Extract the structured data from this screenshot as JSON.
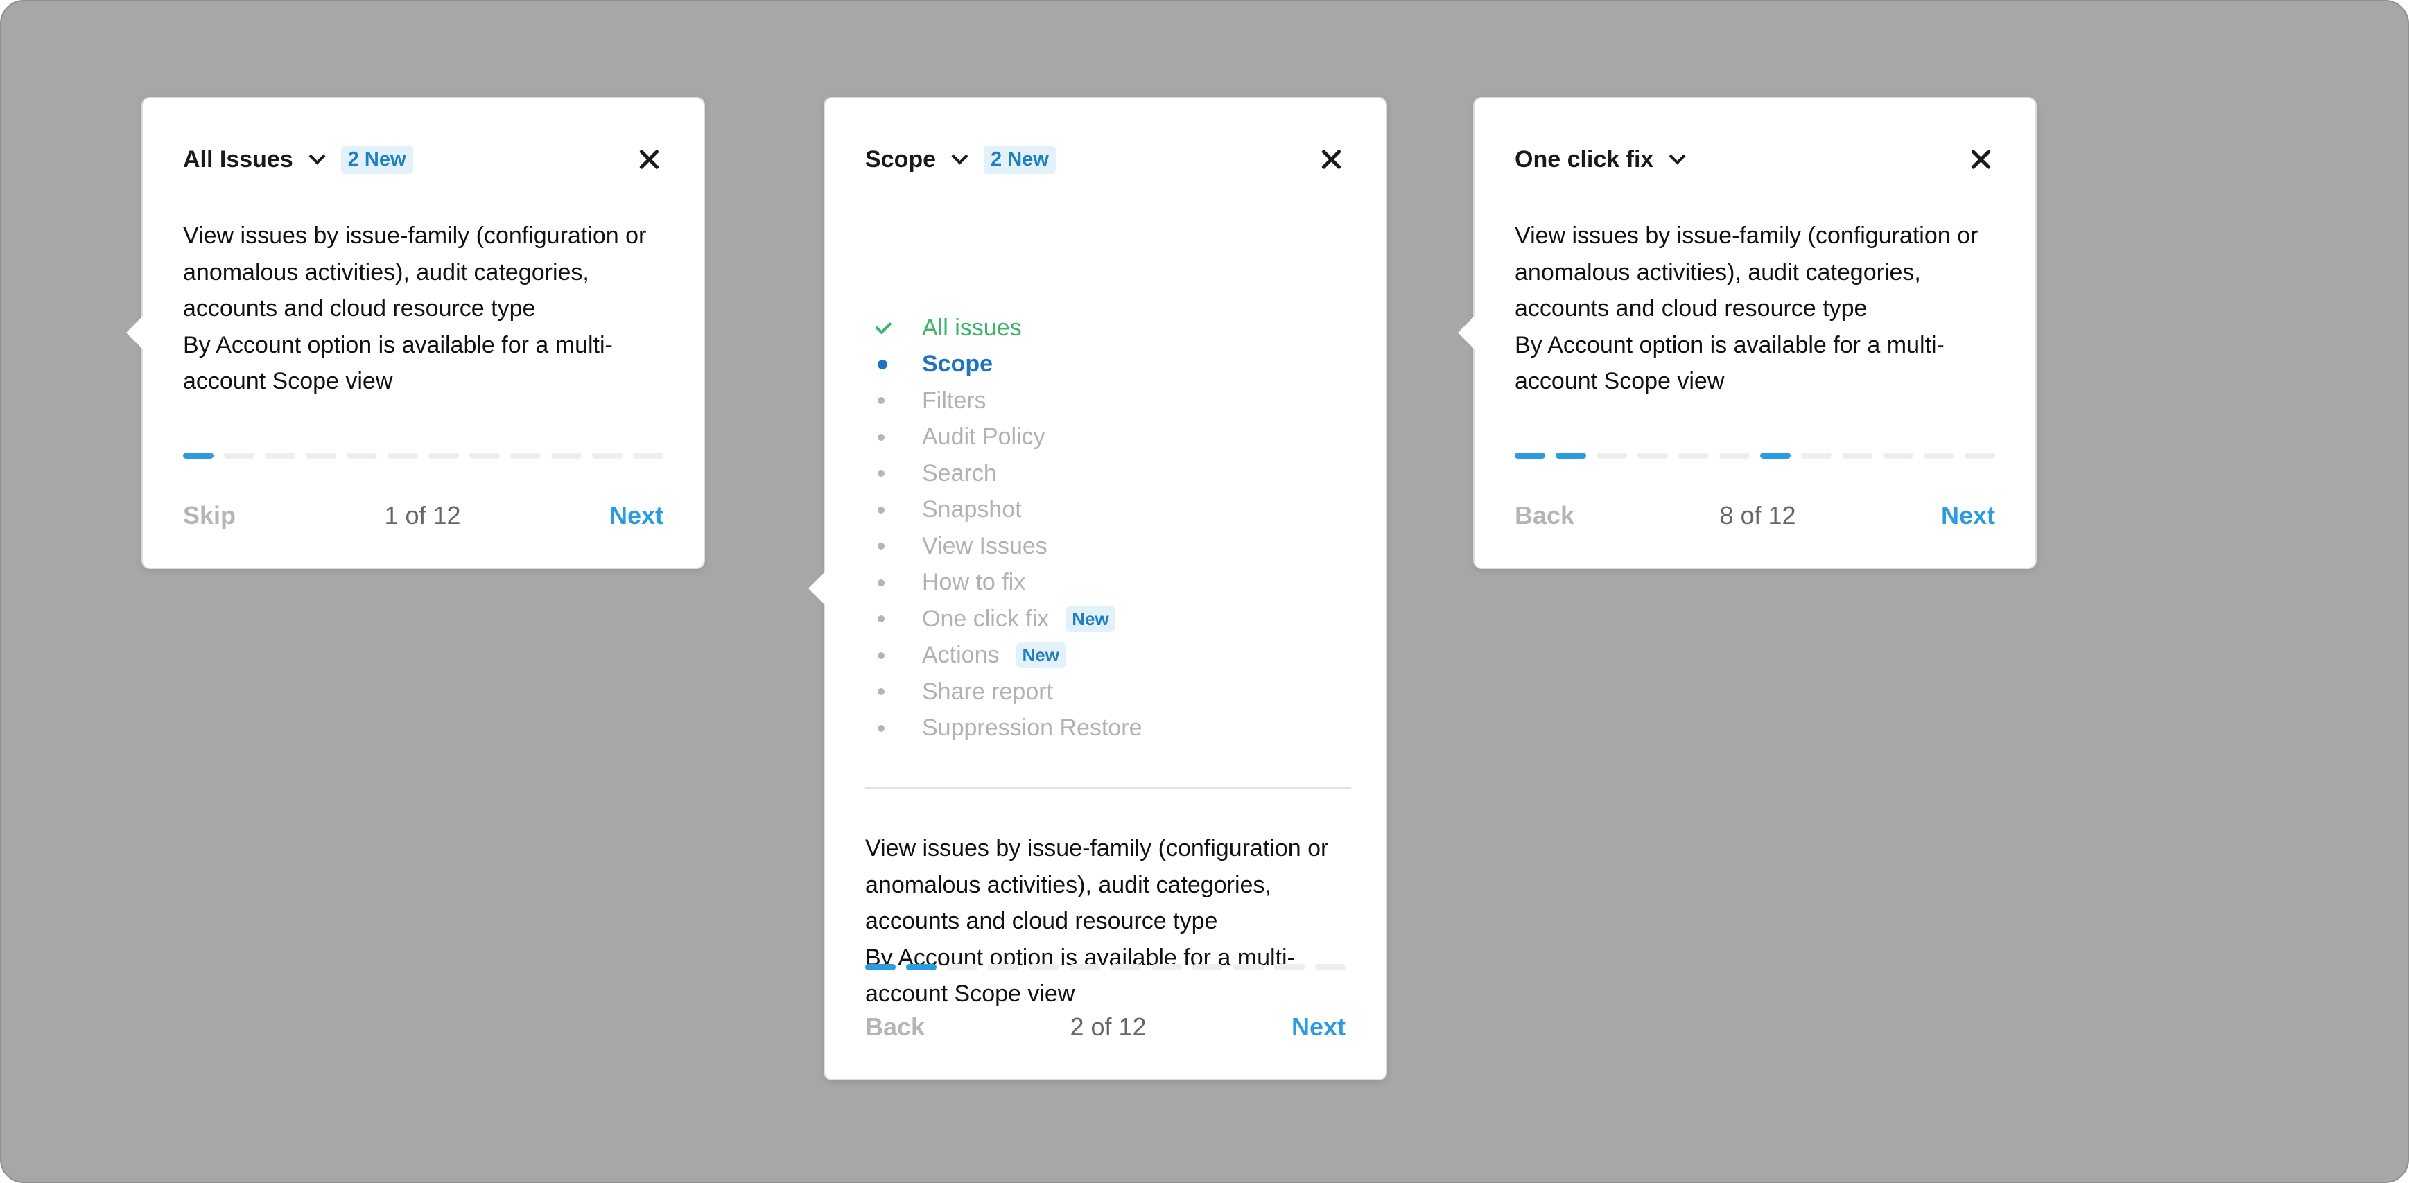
{
  "colors": {
    "background": "#a7a7a7",
    "accent": "#2c9ce0",
    "done": "#3ab56a",
    "current": "#1f73c5",
    "muted": "#b5b5b5"
  },
  "cards": [
    {
      "title": "All Issues",
      "badge": "2 New",
      "description": [
        "View issues by issue-family (configuration or anomalous activities), audit categories, accounts and cloud resource type",
        "By Account option is available for a multi-account Scope view"
      ],
      "progress": {
        "current_step": 1,
        "total_steps": 12,
        "active_dashes": [
          1
        ]
      },
      "footer": {
        "left": "Skip",
        "counter": "1 of 12",
        "right": "Next"
      }
    },
    {
      "title": "Scope",
      "badge": "2 New",
      "steps": [
        {
          "label": "All issues",
          "state": "done",
          "badge": ""
        },
        {
          "label": "Scope",
          "state": "current",
          "badge": ""
        },
        {
          "label": "Filters",
          "state": "pending",
          "badge": ""
        },
        {
          "label": "Audit Policy",
          "state": "pending",
          "badge": ""
        },
        {
          "label": "Search",
          "state": "pending",
          "badge": ""
        },
        {
          "label": "Snapshot",
          "state": "pending",
          "badge": ""
        },
        {
          "label": "View Issues",
          "state": "pending",
          "badge": ""
        },
        {
          "label": "How to fix",
          "state": "pending",
          "badge": ""
        },
        {
          "label": "One click fix",
          "state": "pending",
          "badge": "New"
        },
        {
          "label": "Actions",
          "state": "pending",
          "badge": "New"
        },
        {
          "label": "Share report",
          "state": "pending",
          "badge": ""
        },
        {
          "label": "Suppression Restore",
          "state": "pending",
          "badge": ""
        }
      ],
      "description": [
        "View issues by issue-family (configuration or anomalous activities), audit categories, accounts and cloud resource type",
        "By Account option is available for a multi-account Scope view"
      ],
      "progress": {
        "current_step": 2,
        "total_steps": 12,
        "active_dashes": [
          1,
          2
        ]
      },
      "footer": {
        "left": "Back",
        "counter": "2 of 12",
        "right": "Next"
      }
    },
    {
      "title": "One click fix",
      "badge": "",
      "description": [
        "View issues by issue-family (configuration or anomalous activities), audit categories, accounts and cloud resource type",
        "By Account option is available for a multi-account Scope view"
      ],
      "progress": {
        "current_step": 8,
        "total_steps": 12,
        "active_dashes": [
          1,
          2,
          7
        ]
      },
      "footer": {
        "left": "Back",
        "counter": "8 of 12",
        "right": "Next"
      }
    }
  ]
}
